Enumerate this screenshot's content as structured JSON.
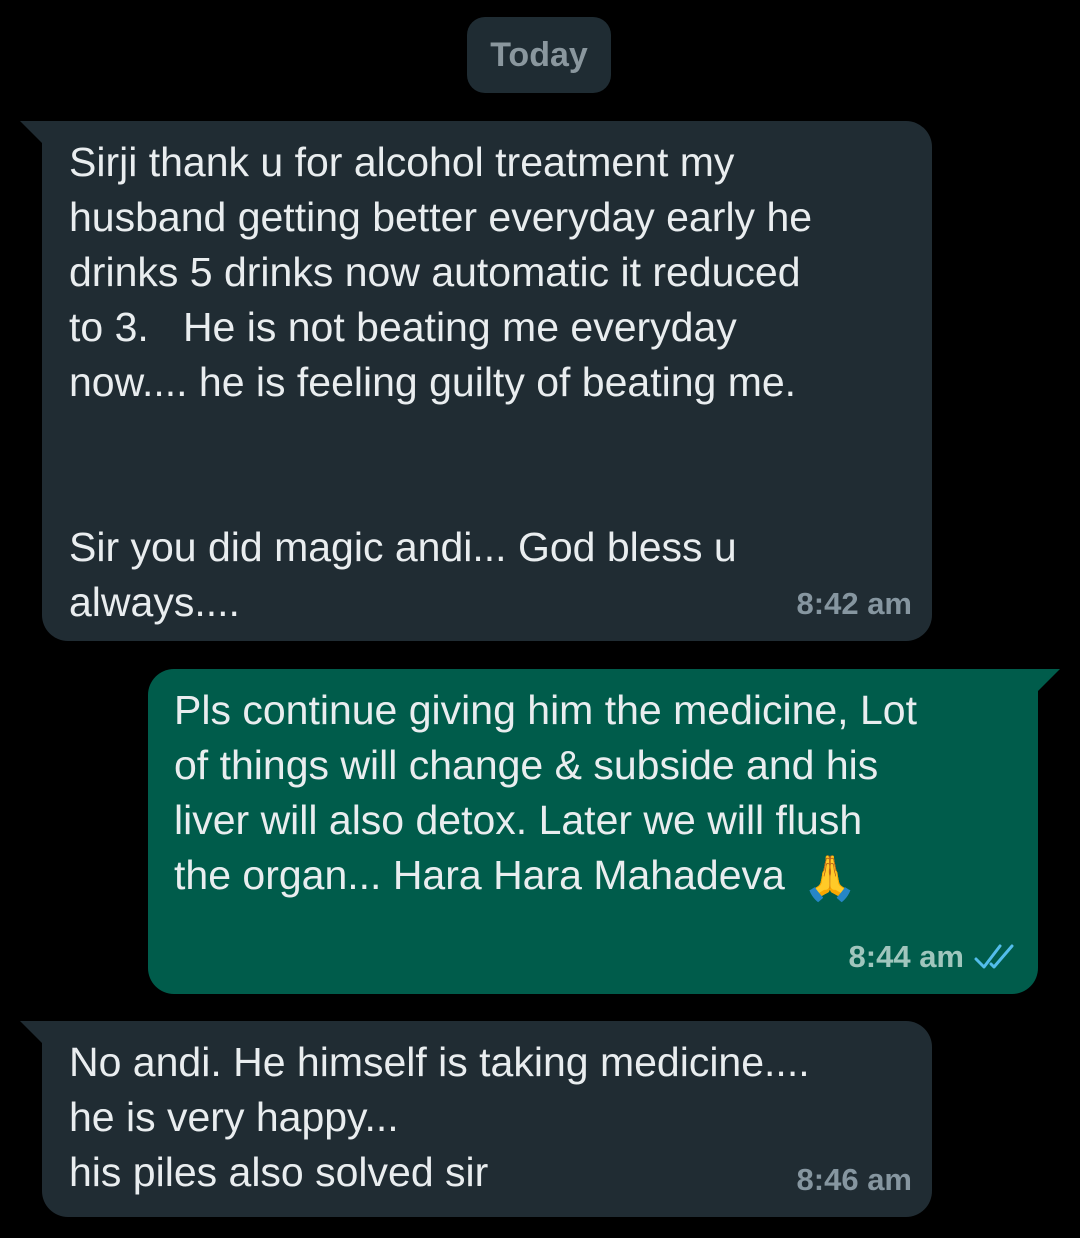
{
  "date_chip": "Today",
  "messages": [
    {
      "direction": "incoming",
      "text": "Sirji thank u for alcohol treatment my\nhusband getting better everyday early he\ndrinks 5 drinks now automatic it reduced\nto 3.   He is not beating me everyday\nnow.... he is feeling guilty of beating me.\n\n\nSir you did magic andi... God bless u\nalways....",
      "time": "8:42 am"
    },
    {
      "direction": "outgoing",
      "text": "Pls continue giving him the medicine, Lot\nof things will change & subside and his\nliver will also detox. Later we will flush\nthe organ... Hara Hara Mahadeva",
      "emoji": "🙏",
      "emoji_name": "folded-hands-icon",
      "time": "8:44 am",
      "status_icon": "double-check-read-icon",
      "status_color": "#53bdeb"
    },
    {
      "direction": "incoming",
      "text": "No andi. He himself is taking medicine....\nhe is very happy...\nhis piles also solved sir",
      "time": "8:46 am"
    }
  ],
  "colors": {
    "background": "#000000",
    "incoming_bubble": "#202c33",
    "outgoing_bubble": "#005c4b",
    "text": "#e9edef",
    "date_chip_bg": "#1f2c33",
    "date_chip_text": "#8a979e"
  }
}
